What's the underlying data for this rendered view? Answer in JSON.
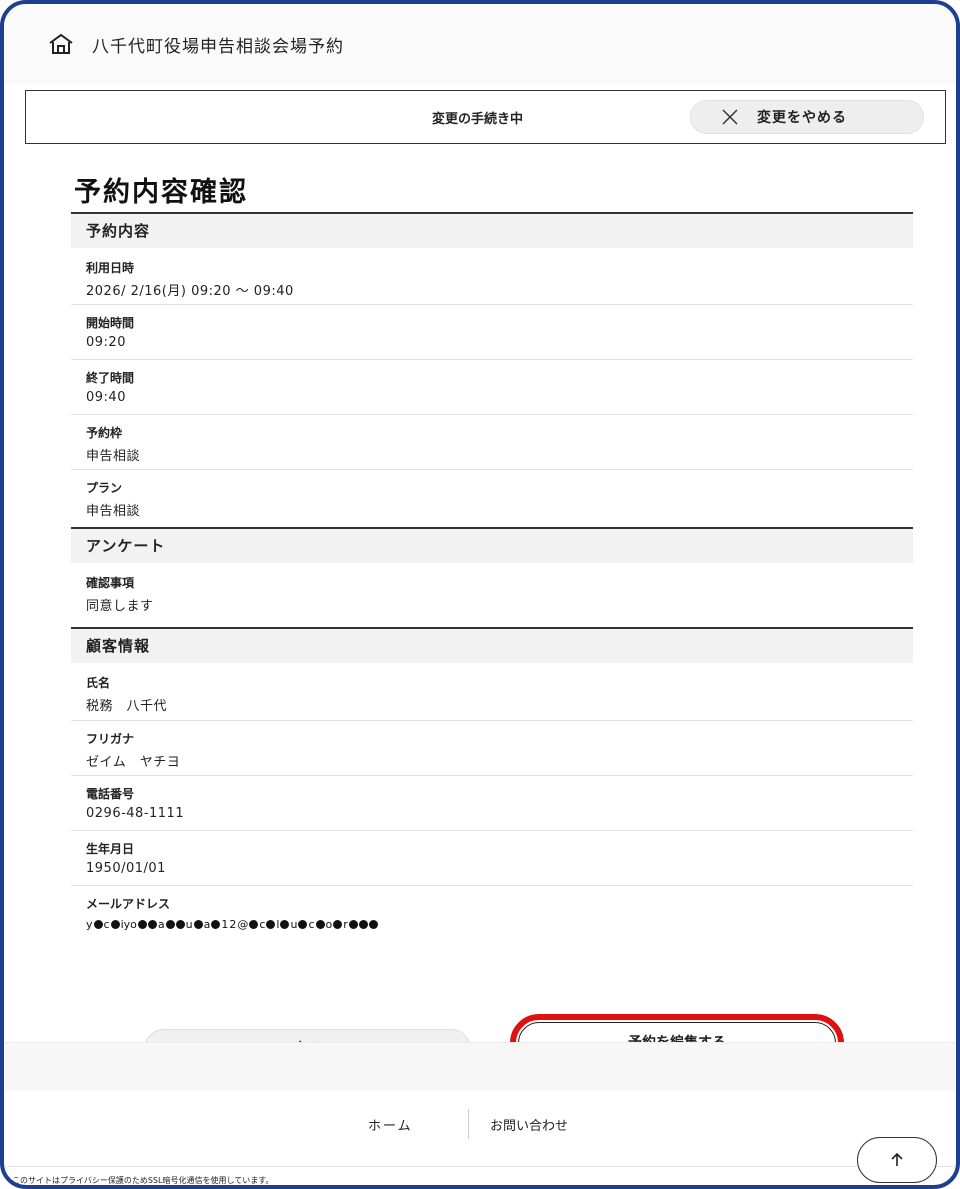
{
  "header": {
    "icon": "home-icon",
    "title": "八千代町役場申告相談会場予約"
  },
  "change_bar": {
    "status": "変更の手続き中",
    "cancel_label": "変更をやめる",
    "cancel_icon": "close-icon"
  },
  "page_title": "予約内容確認",
  "reservation": {
    "heading": "予約内容",
    "fields": [
      {
        "label": "利用日時",
        "value": "2026/ 2/16(月) 09:20 ～ 09:40"
      },
      {
        "label": "開始時間",
        "value": "09:20"
      },
      {
        "label": "終了時間",
        "value": "09:40"
      },
      {
        "label": "予約枠",
        "value": "申告相談"
      },
      {
        "label": "プラン",
        "value": "申告相談"
      }
    ]
  },
  "survey": {
    "heading": "アンケート",
    "fields": [
      {
        "label": "確認事項",
        "value": "同意します"
      }
    ]
  },
  "customer": {
    "heading": "顧客情報",
    "fields": [
      {
        "label": "氏名",
        "value": "税務　八千代"
      },
      {
        "label": "フリガナ",
        "value": "ゼイム　ヤチヨ"
      },
      {
        "label": "電話番号",
        "value": "0296-48-1111"
      },
      {
        "label": "生年月日",
        "value": "1950/01/01"
      },
      {
        "label": "メールアドレス",
        "value": ""
      }
    ]
  },
  "actions": {
    "back_label": "戻る",
    "edit_label": "予約を編集する",
    "highlight_color": "#e01010"
  },
  "footer": {
    "home_label": "ホーム",
    "contact_label": "お問い合わせ",
    "ssl_note": "このサイトはプライバシー保護のためSSL暗号化通信を使用しています。",
    "scroll_top_icon": "arrow-up-icon"
  },
  "colors": {
    "frame_border": "#1d3f8f",
    "section_bg": "#f2f2f2",
    "highlight": "#e01010"
  }
}
